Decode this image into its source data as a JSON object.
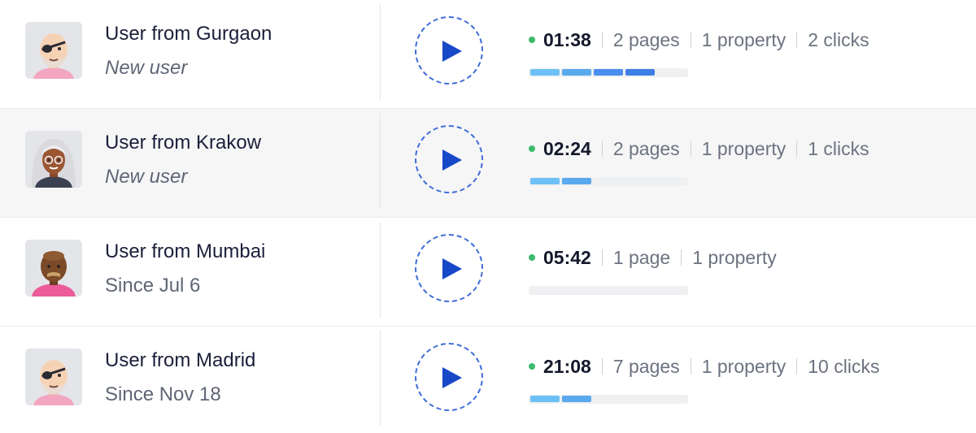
{
  "sessions": [
    {
      "name": "User from Gurgaon",
      "subtitle": "New user",
      "subtitle_italic": true,
      "avatar": "bald-eyepatch-avatar",
      "duration": "01:38",
      "pages": "2 pages",
      "properties": "1 property",
      "clicks": "2 clicks",
      "segments": [
        "#6cc0f5",
        "#5aa9ef",
        "#4a8def",
        "#3e7fe6"
      ],
      "highlighted": false
    },
    {
      "name": "User from Krakow",
      "subtitle": "New user",
      "subtitle_italic": true,
      "avatar": "gray-hair-woman-avatar",
      "duration": "02:24",
      "pages": "2 pages",
      "properties": "1 property",
      "clicks": "1 clicks",
      "segments": [
        "#6cc0f5",
        "#5aa9ef"
      ],
      "highlighted": true
    },
    {
      "name": "User from Mumbai",
      "subtitle": "Since Jul 6",
      "subtitle_italic": false,
      "avatar": "bald-mustache-avatar",
      "duration": "05:42",
      "pages": "1 page",
      "properties": "1 property",
      "clicks": "",
      "segments": [],
      "highlighted": false
    },
    {
      "name": "User from Madrid",
      "subtitle": "Since Nov 18",
      "subtitle_italic": false,
      "avatar": "bald-eyepatch-avatar",
      "duration": "21:08",
      "pages": "7 pages",
      "properties": "1 property",
      "clicks": "10 clicks",
      "segments": [
        "#6cc0f5",
        "#5aa9ef"
      ],
      "highlighted": false
    }
  ],
  "colors": {
    "play_accent": "#1748c8",
    "status_online": "#3dbb6b",
    "highlight_row": "#f6f6f7"
  }
}
